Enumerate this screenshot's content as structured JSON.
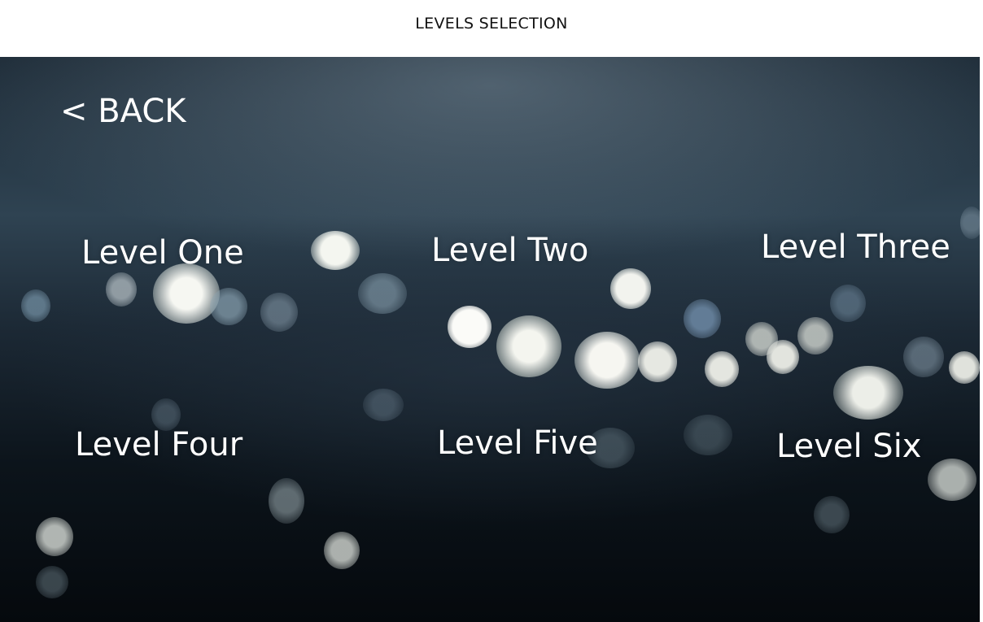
{
  "header": {
    "title": "LEVELS SELECTION"
  },
  "nav": {
    "back_label": "< BACK"
  },
  "levels": [
    {
      "label": "Level One"
    },
    {
      "label": "Level Two"
    },
    {
      "label": "Level Three"
    },
    {
      "label": "Level Four"
    },
    {
      "label": "Level Five"
    },
    {
      "label": "Level Six"
    }
  ],
  "colors": {
    "header_bg": "#ffffff",
    "text_on_image": "#ffffff",
    "background_dark": "#0c141b"
  }
}
